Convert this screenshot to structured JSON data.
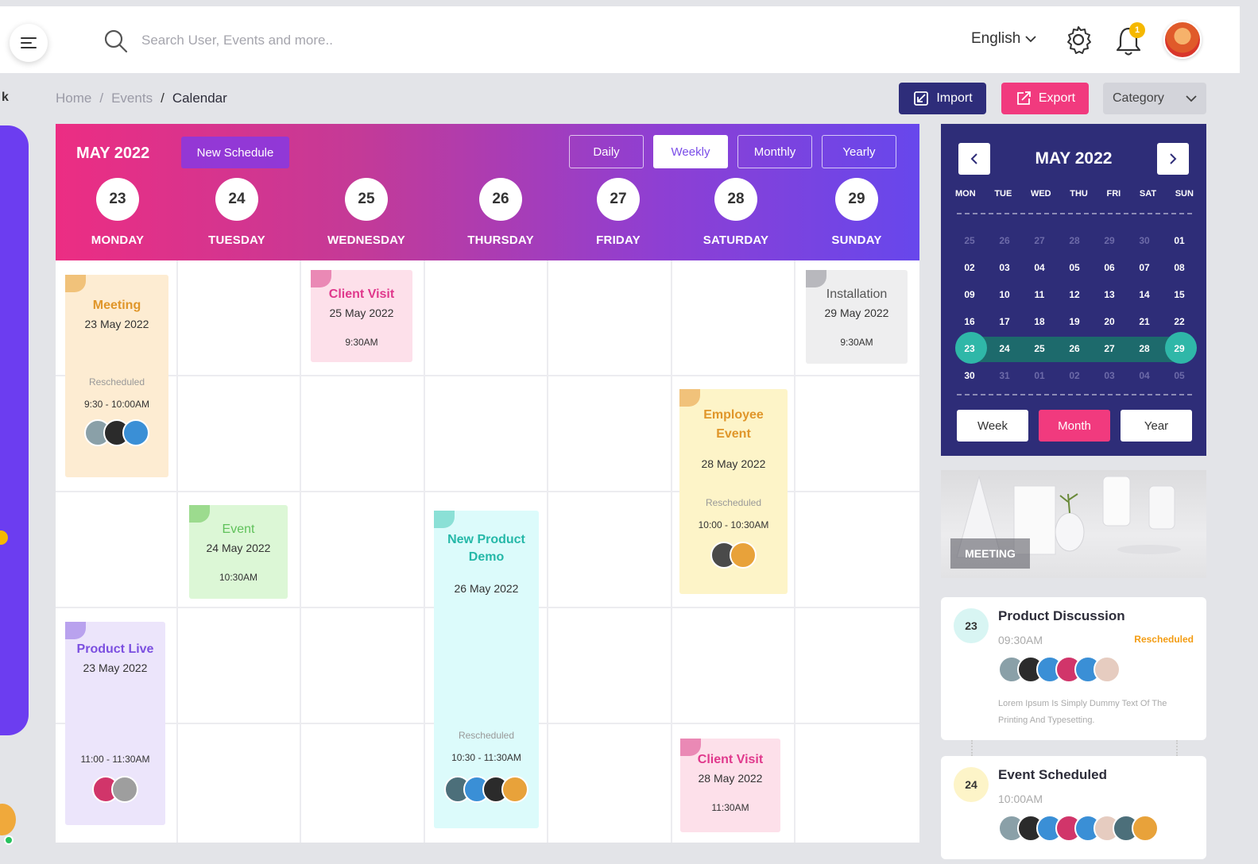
{
  "topbar": {
    "search_placeholder": "Search User, Events and more..",
    "language": "English",
    "notification_count": "1"
  },
  "sidebar": {
    "partial_label": "k"
  },
  "breadcrumb": {
    "items": [
      "Home",
      "Events"
    ],
    "current": "Calendar"
  },
  "actions": {
    "import_label": "Import",
    "export_label": "Export",
    "category_label": "Category"
  },
  "calendar": {
    "month": "MAY 2022",
    "new_schedule_label": "New Schedule",
    "views": [
      "Daily",
      "Weekly",
      "Monthly",
      "Yearly"
    ],
    "active_view": "Weekly",
    "days": [
      {
        "num": "23",
        "name": "MONDAY"
      },
      {
        "num": "24",
        "name": "TUESDAY"
      },
      {
        "num": "25",
        "name": "WEDNESDAY"
      },
      {
        "num": "26",
        "name": "THURSDAY"
      },
      {
        "num": "27",
        "name": "FRIDAY"
      },
      {
        "num": "28",
        "name": "SATURDAY"
      },
      {
        "num": "29",
        "name": "SUNDAY"
      }
    ],
    "events": {
      "meeting": {
        "title": "Meeting",
        "date": "23 May 2022",
        "status": "Rescheduled",
        "time": "9:30 - 10:00AM"
      },
      "client_visit_1": {
        "title": "Client Visit",
        "date": "25 May 2022",
        "time": "9:30AM"
      },
      "installation": {
        "title": "Installation",
        "date": "29 May 2022",
        "time": "9:30AM"
      },
      "employee_event": {
        "title_line1": "Employee",
        "title_line2": "Event",
        "date": "28 May 2022",
        "status": "Rescheduled",
        "time": "10:00 - 10:30AM"
      },
      "event": {
        "title": "Event",
        "date": "24 May 2022",
        "time": "10:30AM"
      },
      "product_demo": {
        "title_line1": "New Product",
        "title_line2": "Demo",
        "date": "26 May 2022",
        "status": "Rescheduled",
        "time": "10:30 - 11:30AM"
      },
      "product_live": {
        "title": "Product Live",
        "date": "23 May 2022",
        "time": "11:00 - 11:30AM"
      },
      "client_visit_2": {
        "title": "Client Visit",
        "date": "28 May 2022",
        "time": "11:30AM"
      }
    }
  },
  "mini_calendar": {
    "title": "MAY 2022",
    "prev_icon": "chevron-left-icon",
    "next_icon": "chevron-right-icon",
    "dow": [
      "MON",
      "TUE",
      "WED",
      "THU",
      "FRI",
      "SAT",
      "SUN"
    ],
    "rows": [
      [
        "25",
        "26",
        "27",
        "28",
        "29",
        "30",
        "01"
      ],
      [
        "02",
        "03",
        "04",
        "05",
        "06",
        "07",
        "08"
      ],
      [
        "09",
        "10",
        "11",
        "12",
        "13",
        "14",
        "15"
      ],
      [
        "16",
        "17",
        "18",
        "19",
        "20",
        "21",
        "22"
      ],
      [
        "23",
        "24",
        "25",
        "26",
        "27",
        "28",
        "29"
      ],
      [
        "30",
        "31",
        "01",
        "02",
        "03",
        "04",
        "05"
      ]
    ],
    "buttons": [
      "Week",
      "Month",
      "Year"
    ],
    "active_button": "Month"
  },
  "meeting_image": {
    "tag": "MEETING"
  },
  "agenda": [
    {
      "day": "23",
      "title": "Product Discussion",
      "time": "09:30AM",
      "status": "Rescheduled",
      "desc": "Lorem Ipsum Is Simply Dummy Text Of The Printing And Typesetting."
    },
    {
      "day": "24",
      "title": "Event Scheduled",
      "time": "10:00AM",
      "status": "",
      "desc": ""
    }
  ],
  "colors": {
    "accent_pink": "#f13a7e",
    "accent_navy": "#2e2d7a",
    "header_gradient_start": "#ec2d83",
    "header_gradient_end": "#6747ec",
    "selected_teal": "#2fb7a8"
  }
}
